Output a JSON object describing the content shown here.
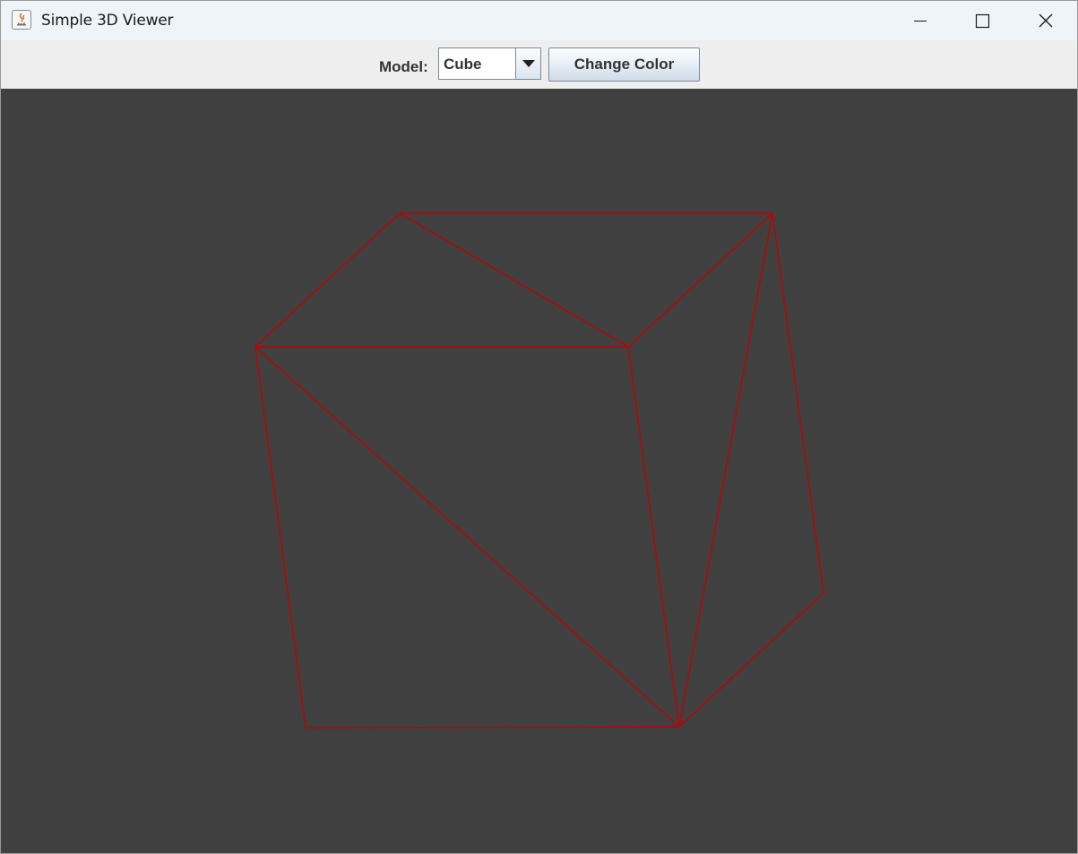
{
  "window": {
    "title": "Simple 3D Viewer",
    "icon": "java-app-icon"
  },
  "window_controls": {
    "minimize_icon": "minimize-icon",
    "maximize_icon": "maximize-icon",
    "close_icon": "close-icon"
  },
  "toolbar": {
    "model_label": "Model:",
    "model_select": {
      "selected": "Cube"
    },
    "change_color_label": "Change Color"
  },
  "viewport": {
    "background_color": "#404040",
    "wire_color": "#c00000",
    "model": "Cube"
  }
}
